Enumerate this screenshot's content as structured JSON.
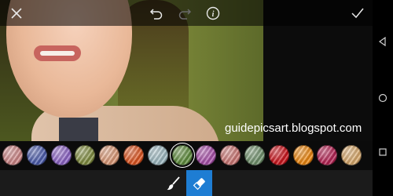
{
  "topbar": {
    "close_icon": "close-icon",
    "undo_icon": "undo-icon",
    "redo_icon": "redo-icon",
    "info_icon": "info-icon",
    "info_glyph": "i",
    "apply_icon": "checkmark-icon"
  },
  "watermark": "guidepicsart.blogspot.com",
  "swatches": [
    {
      "color": "#c98384",
      "selected": false
    },
    {
      "color": "#4a5aa8",
      "selected": false
    },
    {
      "color": "#8a62c2",
      "selected": false
    },
    {
      "color": "#7d8a3e",
      "selected": false
    },
    {
      "color": "#d79674",
      "selected": false
    },
    {
      "color": "#d9521e",
      "selected": false
    },
    {
      "color": "#9bb6be",
      "selected": false
    },
    {
      "color": "#5d8a3c",
      "selected": true
    },
    {
      "color": "#a54ea6",
      "selected": false
    },
    {
      "color": "#c87572",
      "selected": false
    },
    {
      "color": "#6e8e6a",
      "selected": false
    },
    {
      "color": "#c8141c",
      "selected": false
    },
    {
      "color": "#e8840e",
      "selected": false
    },
    {
      "color": "#b22252",
      "selected": false
    },
    {
      "color": "#d5a66a",
      "selected": false
    }
  ],
  "tools": {
    "brush_icon": "brush-icon",
    "eraser_icon": "eraser-icon",
    "active": "eraser",
    "active_color": "#1e7dd3"
  },
  "navbar": {
    "back_icon": "back-triangle-icon",
    "home_icon": "home-circle-icon",
    "recents_icon": "recents-square-icon"
  }
}
